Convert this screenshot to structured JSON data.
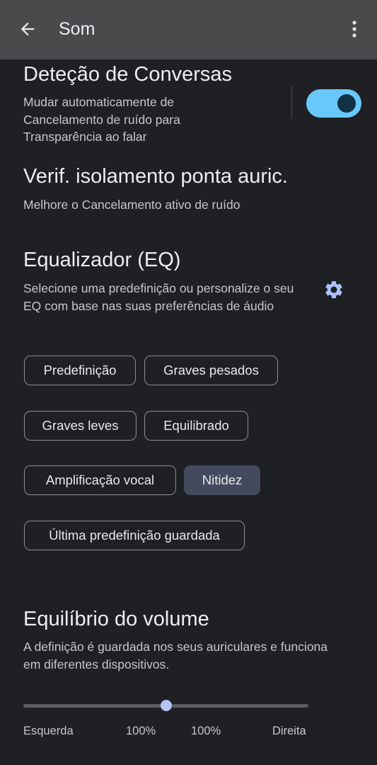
{
  "appbar": {
    "title": "Som",
    "back_icon": "arrow-back-icon",
    "more_icon": "more-vert-icon"
  },
  "conversation": {
    "title": "Deteção de Conversas",
    "description": "Mudar automaticamente de Cancelamento de ruído para Transparência ao falar",
    "toggle_on": true
  },
  "eartip": {
    "title": "Verif. isolamento ponta auric.",
    "description": "Melhore o Cancelamento ativo de ruído"
  },
  "eq": {
    "title": "Equalizador (EQ)",
    "description": "Selecione uma predefinição ou personalize o seu EQ com base nas suas preferências de áudio",
    "settings_icon": "gear-icon",
    "presets": [
      "Predefinição",
      "Graves pesados",
      "Graves leves",
      "Equilibrado",
      "Amplificação vocal",
      "Nitidez",
      "Última predefinição guardada"
    ],
    "selected": "Nitidez"
  },
  "balance": {
    "title": "Equilíbrio do volume",
    "description": "A definição é guardada nos seus auriculares e funciona em diferentes dispositivos.",
    "value": 0.5,
    "left_label": "Esquerda",
    "left_value": "100%",
    "right_value": "100%",
    "right_label": "Direita"
  },
  "colors": {
    "accent": "#69c8fb",
    "selected_chip": "#434a5e",
    "background": "#1e2024"
  }
}
